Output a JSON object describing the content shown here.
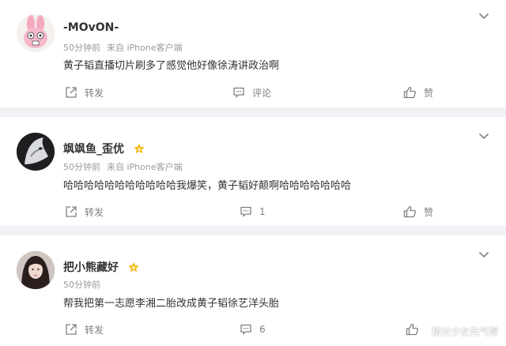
{
  "comments": [
    {
      "user": "-MOvON-",
      "time": "50分钟前",
      "source": "来自 iPhone客户端",
      "text": "黄子韬直播切片刷多了感觉他好像徐涛讲政治啊",
      "actions": {
        "repost": "转发",
        "comment": "评论",
        "like": "赞"
      },
      "avatar": "pink-bunny-cartoon",
      "verified_badge": false
    },
    {
      "user": "飒飒鱼_歪优",
      "time": "50分钟前",
      "source": "来自 iPhone客户端",
      "text": "哈哈哈哈哈哈哈哈哈哈哈我爆笑，黄子韬好颠啊哈哈哈哈哈哈哈",
      "actions": {
        "repost": "转发",
        "comment": "1",
        "like": "赞"
      },
      "avatar": "dark-wolf-photo",
      "verified_badge": true
    },
    {
      "user": "把小熊藏好",
      "time": "50分钟前",
      "source": "",
      "text": "帮我把第一志愿李湘二胎改成黄子韬徐艺洋头胎",
      "actions": {
        "repost": "转发",
        "comment": "6",
        "like": "赞"
      },
      "avatar": "girl-portrait-photo",
      "verified_badge": true
    }
  ],
  "watermark": "精分少女元气帮",
  "colors": {
    "background": "#f1f2f5",
    "text": "#333333",
    "meta": "#9a9a9a",
    "action": "#808080",
    "badge": "#f7b500"
  }
}
